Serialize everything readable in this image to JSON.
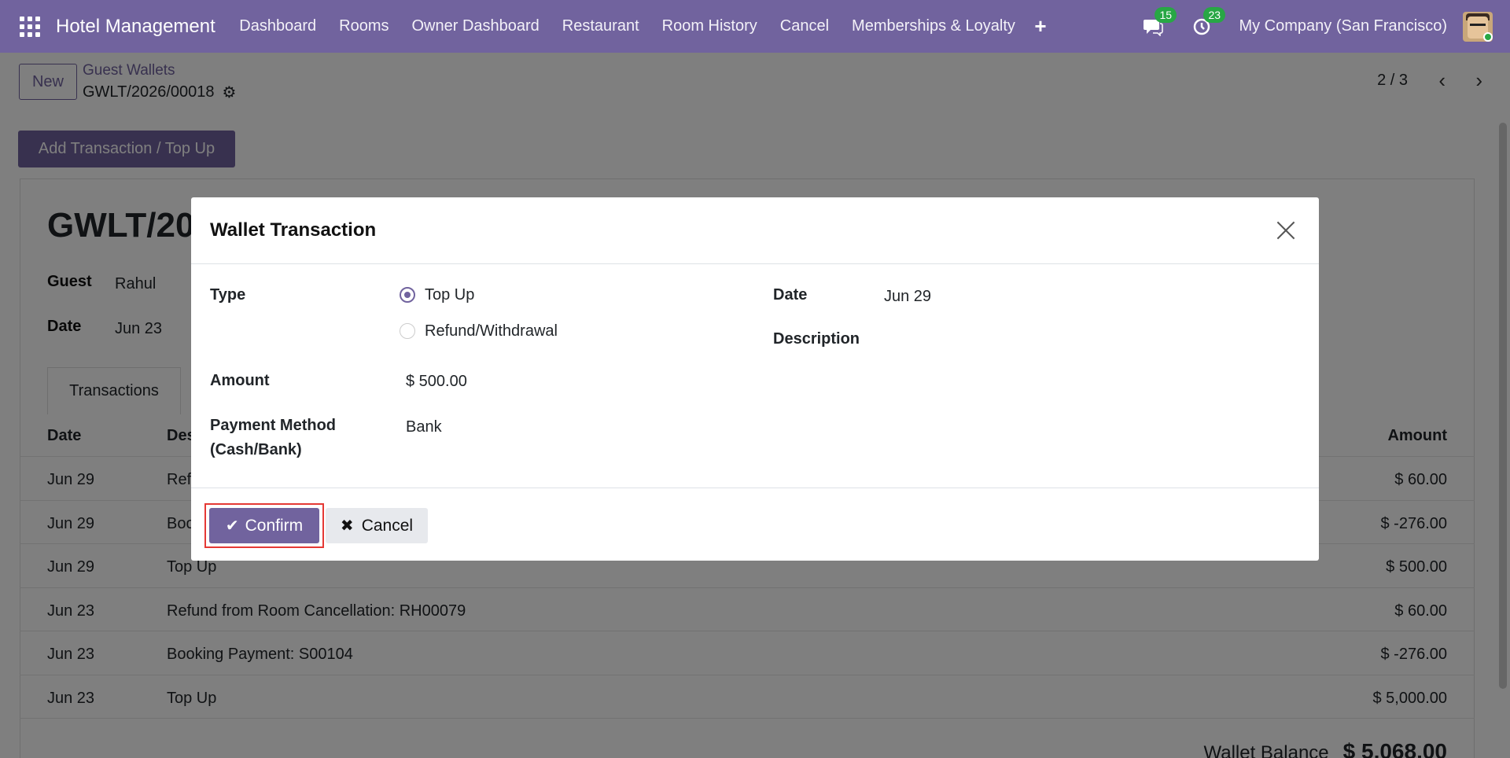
{
  "navbar": {
    "app_name": "Hotel Management",
    "menu": [
      "Dashboard",
      "Rooms",
      "Owner Dashboard",
      "Restaurant",
      "Room History",
      "Cancel",
      "Memberships & Loyalty"
    ],
    "messages_count": "15",
    "activities_count": "23",
    "company": "My Company (San Francisco)"
  },
  "control_panel": {
    "new_label": "New",
    "breadcrumb": "Guest Wallets",
    "record_name": "GWLT/2026/00018",
    "pager": "2 / 3"
  },
  "form": {
    "action_button": "Add Transaction / Top Up",
    "title": "GWLT/202",
    "guest_label": "Guest",
    "guest_value": "Rahul",
    "date_label": "Date",
    "date_value": "Jun 23",
    "tab_label": "Transactions",
    "columns": {
      "date": "Date",
      "description": "Des",
      "amount": "Amount"
    },
    "rows": [
      {
        "date": "Jun 29",
        "description": "Ref",
        "amount": "$ 60.00"
      },
      {
        "date": "Jun 29",
        "description": "Boo",
        "amount": "$ -276.00"
      },
      {
        "date": "Jun 29",
        "description": "Top Up",
        "amount": "$ 500.00"
      },
      {
        "date": "Jun 23",
        "description": "Refund from Room Cancellation: RH00079",
        "amount": "$ 60.00"
      },
      {
        "date": "Jun 23",
        "description": "Booking Payment: S00104",
        "amount": "$ -276.00"
      },
      {
        "date": "Jun 23",
        "description": "Top Up",
        "amount": "$ 5,000.00"
      }
    ],
    "balance_label": "Wallet Balance",
    "balance_value": "$ 5,068.00"
  },
  "modal": {
    "title": "Wallet Transaction",
    "type_label": "Type",
    "type_options": [
      "Top Up",
      "Refund/Withdrawal"
    ],
    "type_selected": "Top Up",
    "amount_label": "Amount",
    "amount_value": "$ 500.00",
    "payment_label_line1": "Payment Method",
    "payment_label_line2": "(Cash/Bank)",
    "payment_value": "Bank",
    "date_label": "Date",
    "date_value": "Jun 29",
    "description_label": "Description",
    "confirm_label": "Confirm",
    "cancel_label": "Cancel"
  },
  "colors": {
    "primary": "#71639e",
    "badge": "#28a745",
    "highlight": "#e53935"
  }
}
